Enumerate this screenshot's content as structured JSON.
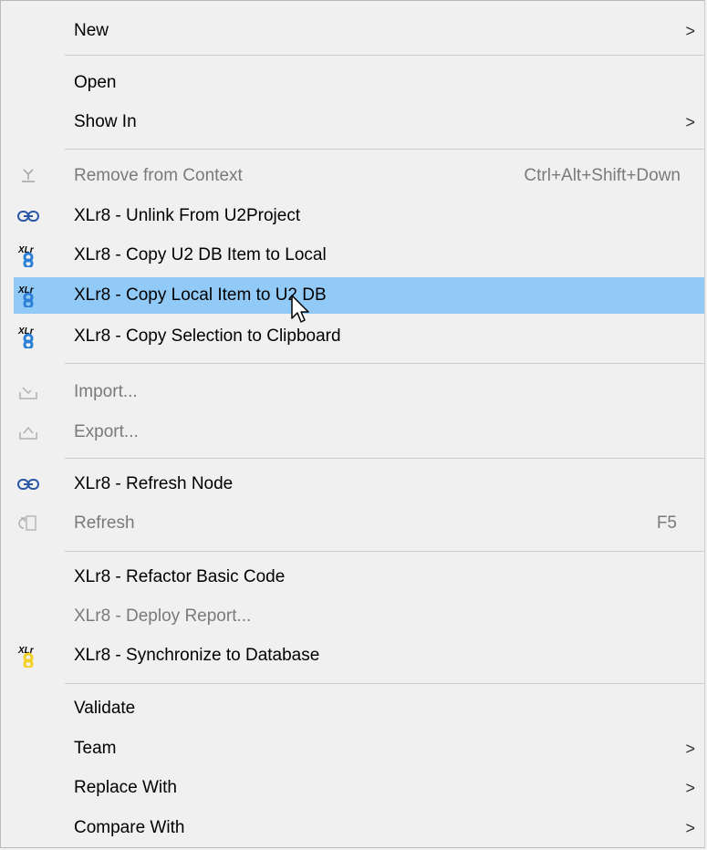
{
  "menu": {
    "new": {
      "label": "New",
      "arrow": ">"
    },
    "open": {
      "label": "Open"
    },
    "show_in": {
      "label": "Show In",
      "arrow": ">"
    },
    "remove_from_context": {
      "label": "Remove from Context",
      "shortcut": "Ctrl+Alt+Shift+Down"
    },
    "unlink_u2project": {
      "label": "XLr8 - Unlink From U2Project"
    },
    "copy_db_to_local": {
      "label": "XLr8 - Copy U2 DB Item to Local"
    },
    "copy_local_to_db": {
      "label": "XLr8 - Copy Local Item to U2 DB"
    },
    "copy_selection": {
      "label": "XLr8 - Copy Selection to Clipboard"
    },
    "import": {
      "label": "Import..."
    },
    "export": {
      "label": "Export..."
    },
    "refresh_node": {
      "label": "XLr8 - Refresh Node"
    },
    "refresh": {
      "label": "Refresh",
      "shortcut": "F5"
    },
    "refactor": {
      "label": "XLr8 - Refactor Basic Code"
    },
    "deploy_report": {
      "label": "XLr8 - Deploy Report..."
    },
    "synchronize": {
      "label": "XLr8 - Synchronize to Database"
    },
    "validate": {
      "label": "Validate"
    },
    "team": {
      "label": "Team",
      "arrow": ">"
    },
    "replace_with": {
      "label": "Replace With",
      "arrow": ">"
    },
    "compare_with": {
      "label": "Compare With",
      "arrow": ">"
    }
  },
  "colors": {
    "menu_background": "#f0f0f0",
    "highlight": "#91c9f7",
    "disabled_text": "#7a7a7a"
  },
  "icons": {
    "xlr8_logo_text": "XLr"
  }
}
